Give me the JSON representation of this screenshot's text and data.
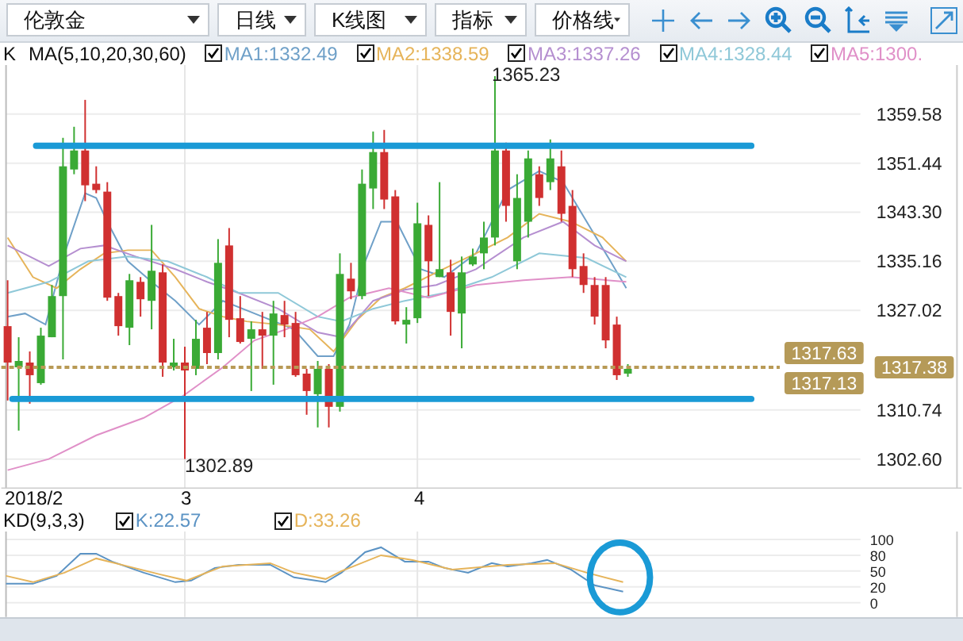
{
  "toolbar": {
    "dropdowns": [
      {
        "label": "伦敦金"
      },
      {
        "label": "日线"
      },
      {
        "label": "K线图"
      },
      {
        "label": "指标"
      },
      {
        "label": "价格线"
      }
    ]
  },
  "legend": {
    "indicator": "K",
    "params": "MA(5,10,20,30,60)",
    "lines": [
      {
        "label": "MA1:1332.49",
        "color": "#6fa0c8",
        "checked": true
      },
      {
        "label": "MA2:1338.59",
        "color": "#e6b45a",
        "checked": true
      },
      {
        "label": "MA3:1337.26",
        "color": "#b58fd0",
        "checked": true
      },
      {
        "label": "MA4:1328.44",
        "color": "#8fc8d8",
        "checked": true
      },
      {
        "label": "MA5:1300.",
        "color": "#e090c8",
        "checked": true
      }
    ]
  },
  "price_chart": {
    "y_axis_labels": [
      "1359.58",
      "1351.44",
      "1343.30",
      "1335.16",
      "1327.02",
      "1310.74",
      "1302.60"
    ],
    "price_tags": [
      "1317.63",
      "1317.13",
      "1317.38"
    ],
    "high_label": "1365.23",
    "low_label": "1302.89"
  },
  "date_axis": [
    "2018/2",
    "3",
    "4"
  ],
  "kd": {
    "indicator": "KD(9,3,3)",
    "lines": [
      {
        "label": "K:22.57",
        "color": "#5b93c4",
        "checked": true
      },
      {
        "label": "D:33.26",
        "color": "#e6b45a",
        "checked": true
      }
    ],
    "y_axis_labels": [
      "100",
      "80",
      "50",
      "20",
      "0"
    ]
  }
}
